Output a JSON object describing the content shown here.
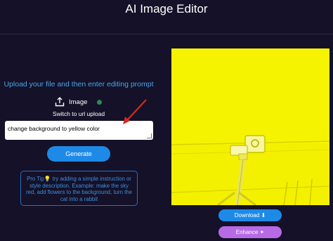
{
  "header": {
    "title": "AI Image Editor"
  },
  "upload": {
    "prompt": "Upload your file and then enter editing prompt",
    "image_label": "Image",
    "switch_label": "Switch to url upload"
  },
  "editor": {
    "prompt_value": "change background to yellow color",
    "generate_label": "Generate"
  },
  "tip": {
    "text": "Pro Tip💡 try adding a simple instruction or style description. Example: make the sky red, add flowers to the background, turn the cat into a rabbit"
  },
  "actions": {
    "download_label": "Download ⬇",
    "enhance_label": "Enhance ✦"
  },
  "colors": {
    "background": "#141128",
    "accent_blue": "#1e8ae8",
    "accent_purple": "#b86ae6",
    "preview_yellow": "#f4f100",
    "arrow_red": "#d62a1e"
  },
  "icons": [
    "upload-icon",
    "check-icon",
    "red-arrow-icon"
  ]
}
